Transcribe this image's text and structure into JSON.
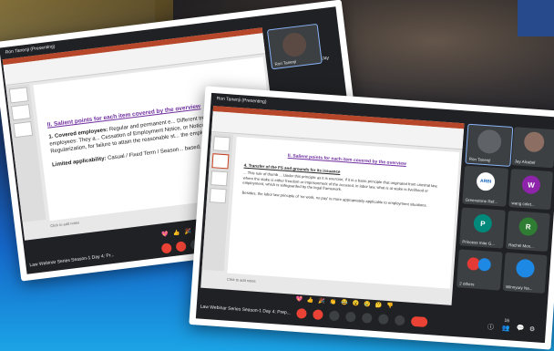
{
  "back_window": {
    "title": "Ron Tanenji (Presenting)",
    "slide_heading": "II. Salient points for each item covered by the overview",
    "bullet_heading": "1.  Covered employees:",
    "bullet_text": "Regular and permanent e... Different treatment; Probationary employees: They a... Cessation of Employment Notice, or Notice of Non-... Regularization, for failure to attain the reasonable st... the employer (PARSE).",
    "limited_label": "Limited applicability:",
    "limited_text": "Casual / Fixed Term / Season... based.",
    "notes_placeholder": "Click to add notes",
    "meeting_name": "Law Webinar Series Season-1 Day 4: Pr...",
    "tile_label": "Ron Tanenji",
    "side_label": "Jay"
  },
  "front_window": {
    "title": "Ron Tanenji (Presenting)",
    "slide_heading": "II. Salient points for each item covered by the overview",
    "point_heading": "4. Transfer of the FS and grounds for its issuance",
    "point_text": "... This rule of thumb ... Under this principle as it is exercise, if it is a basic principle that originated from criminal law, where the stake is either freedom or imprisonment of the accused, in labor law, what is at stake is livelihood or employment, which is safeguarded by the legal framework.",
    "closing_text": "Besides, the labor law principle of 'no work, no pay' is more appropriately applicable to employment situations.",
    "notes_placeholder": "Click to add notes",
    "meeting_name": "Law Webinar Series Season-1 Day 4: Prep...",
    "participants": [
      {
        "name": "Ron Tanenji",
        "initial": "",
        "color": "#5f6368"
      },
      {
        "name": "Jay Alcabel",
        "initial": "",
        "color": "#8d6e63"
      },
      {
        "name": "Greenstone Ref...",
        "initial": "ARBI",
        "color": "#ffffff"
      },
      {
        "name": "wang colet...",
        "initial": "W",
        "color": "#8e24aa"
      },
      {
        "name": "Princess mae G...",
        "initial": "P",
        "color": "#00897b"
      },
      {
        "name": "Rachel Mon...",
        "initial": "R",
        "color": "#2e7d32"
      },
      {
        "name": "2 others",
        "initial": "",
        "color": "#e53935"
      },
      {
        "name": "Winnyury Na...",
        "initial": "",
        "color": "#1e88e5"
      }
    ],
    "reactions": [
      "💖",
      "👍",
      "🎉",
      "👏",
      "😂",
      "😮",
      "😢",
      "🤔",
      "👎"
    ],
    "badge_count": "16"
  }
}
